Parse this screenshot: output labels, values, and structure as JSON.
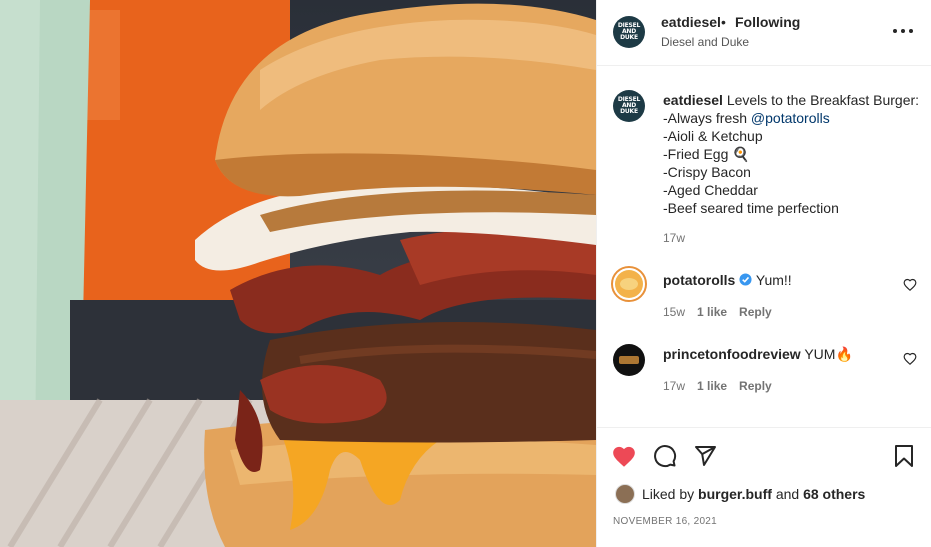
{
  "post": {
    "username": "eatdiesel",
    "follow_status": "Following",
    "location": "Diesel and Duke",
    "avatar_text": [
      "DIESEL",
      "AND",
      "DUKE"
    ],
    "caption_user": "eatdiesel",
    "caption_intro": "Levels to the Breakfast Burger:",
    "caption_line1_prefix": "-Always fresh ",
    "caption_mention": "@potatorolls",
    "caption_rest": "-Aioli & Ketchup\n-Fried Egg 🍳\n-Crispy Bacon\n-Aged Cheddar\n-Beef seared time perfection",
    "caption_time": "17w"
  },
  "comments": [
    {
      "user": "potatorolls",
      "verified": true,
      "text": "Yum!!",
      "time": "15w",
      "likes": "1 like",
      "reply": "Reply"
    },
    {
      "user": "princetonfoodreview",
      "verified": false,
      "text": "YUM🔥",
      "time": "17w",
      "likes": "1 like",
      "reply": "Reply"
    }
  ],
  "actions": {
    "liked_prefix": "Liked by",
    "liked_user": "burger.buff",
    "liked_mid": "and",
    "liked_others": "68 others",
    "date": "NOVEMBER 16, 2021"
  },
  "colors": {
    "like_red": "#ed4956",
    "mention_blue": "#00376b",
    "verified_blue": "#3897f0",
    "muted_text": "#737373"
  },
  "icons": [
    "more-icon",
    "heart-filled-icon",
    "comment-icon",
    "share-icon",
    "bookmark-icon",
    "heart-outline-icon",
    "verified-badge-icon"
  ]
}
